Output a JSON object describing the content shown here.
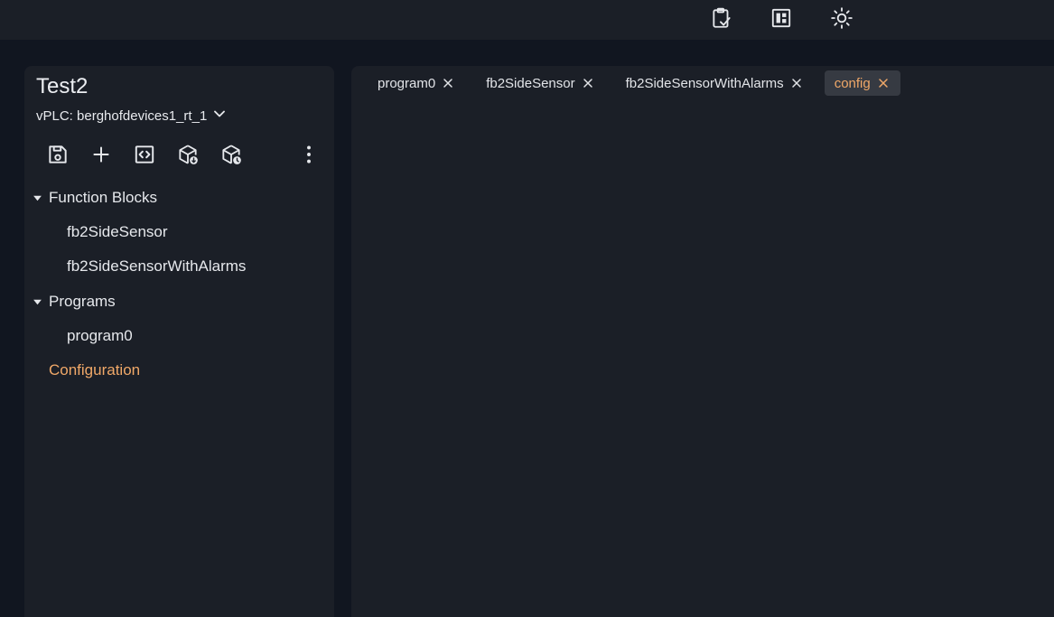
{
  "colors": {
    "accent": "#f0a868",
    "background": "#111620",
    "panel": "#1b1f27",
    "active_tab": "#363a42"
  },
  "topbar": {
    "icons": [
      "clipboard-check-icon",
      "dashboard-panel-icon",
      "sun-icon"
    ]
  },
  "sidebar": {
    "project_title": "Test2",
    "vplc_label": "vPLC: berghofdevices1_rt_1",
    "toolbar_icons": [
      "save-icon",
      "add-icon",
      "code-icon",
      "package-download-icon",
      "package-clock-icon",
      "more-vertical-icon"
    ],
    "tree": {
      "function_blocks": {
        "label": "Function Blocks",
        "items": [
          "fb2SideSensor",
          "fb2SideSensorWithAlarms"
        ]
      },
      "programs": {
        "label": "Programs",
        "items": [
          "program0"
        ]
      },
      "configuration": "Configuration"
    }
  },
  "editor": {
    "tabs": [
      {
        "label": "program0",
        "active": false
      },
      {
        "label": "fb2SideSensor",
        "active": false
      },
      {
        "label": "fb2SideSensorWithAlarms",
        "active": false
      },
      {
        "label": "config",
        "active": true
      }
    ]
  }
}
